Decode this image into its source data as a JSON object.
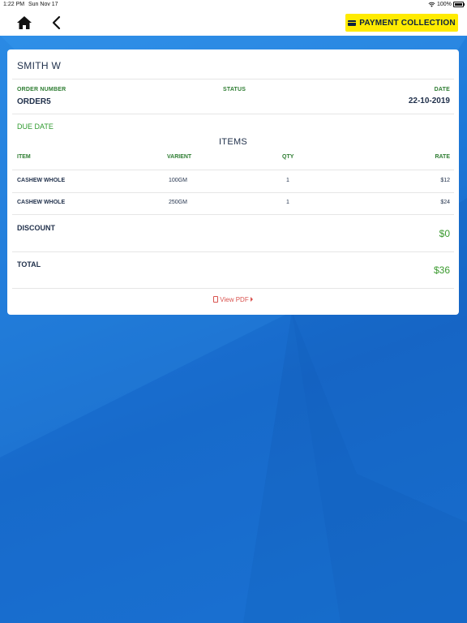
{
  "status_bar": {
    "time": "1:22 PM",
    "date": "Sun Nov 17",
    "battery": "100%",
    "icons": [
      "wifi-icon",
      "battery-icon"
    ]
  },
  "nav": {
    "home_icon": "home-icon",
    "back_icon": "chevron-left-icon",
    "payment_button": "PAYMENT COLLECTION",
    "payment_icon": "card-icon"
  },
  "order": {
    "customer": "SMITH W",
    "order_number_label": "ORDER NUMBER",
    "order_number": "ORDER5",
    "status_label": "STATUS",
    "status": "",
    "date_label": "DATE",
    "date": "22-10-2019",
    "due_date_label": "DUE DATE"
  },
  "items": {
    "title": "ITEMS",
    "headers": {
      "item": "ITEM",
      "variant": "VARIENT",
      "qty": "QTY",
      "rate": "RATE"
    },
    "rows": [
      {
        "item": "CASHEW WHOLE",
        "variant": "100GM",
        "qty": "1",
        "rate": "$12"
      },
      {
        "item": "CASHEW WHOLE",
        "variant": "250GM",
        "qty": "1",
        "rate": "$24"
      }
    ]
  },
  "summary": {
    "discount_label": "DISCOUNT",
    "discount": "$0",
    "total_label": "TOTAL",
    "total": "$36"
  },
  "pdf_link": "View PDF",
  "colors": {
    "accent_yellow": "#ffeb00",
    "label_green": "#2e7d32",
    "amount_green": "#3a9a2e",
    "text_navy": "#1f2f4a",
    "link_red": "#d9534f",
    "background_blue": "#1d78d8"
  }
}
